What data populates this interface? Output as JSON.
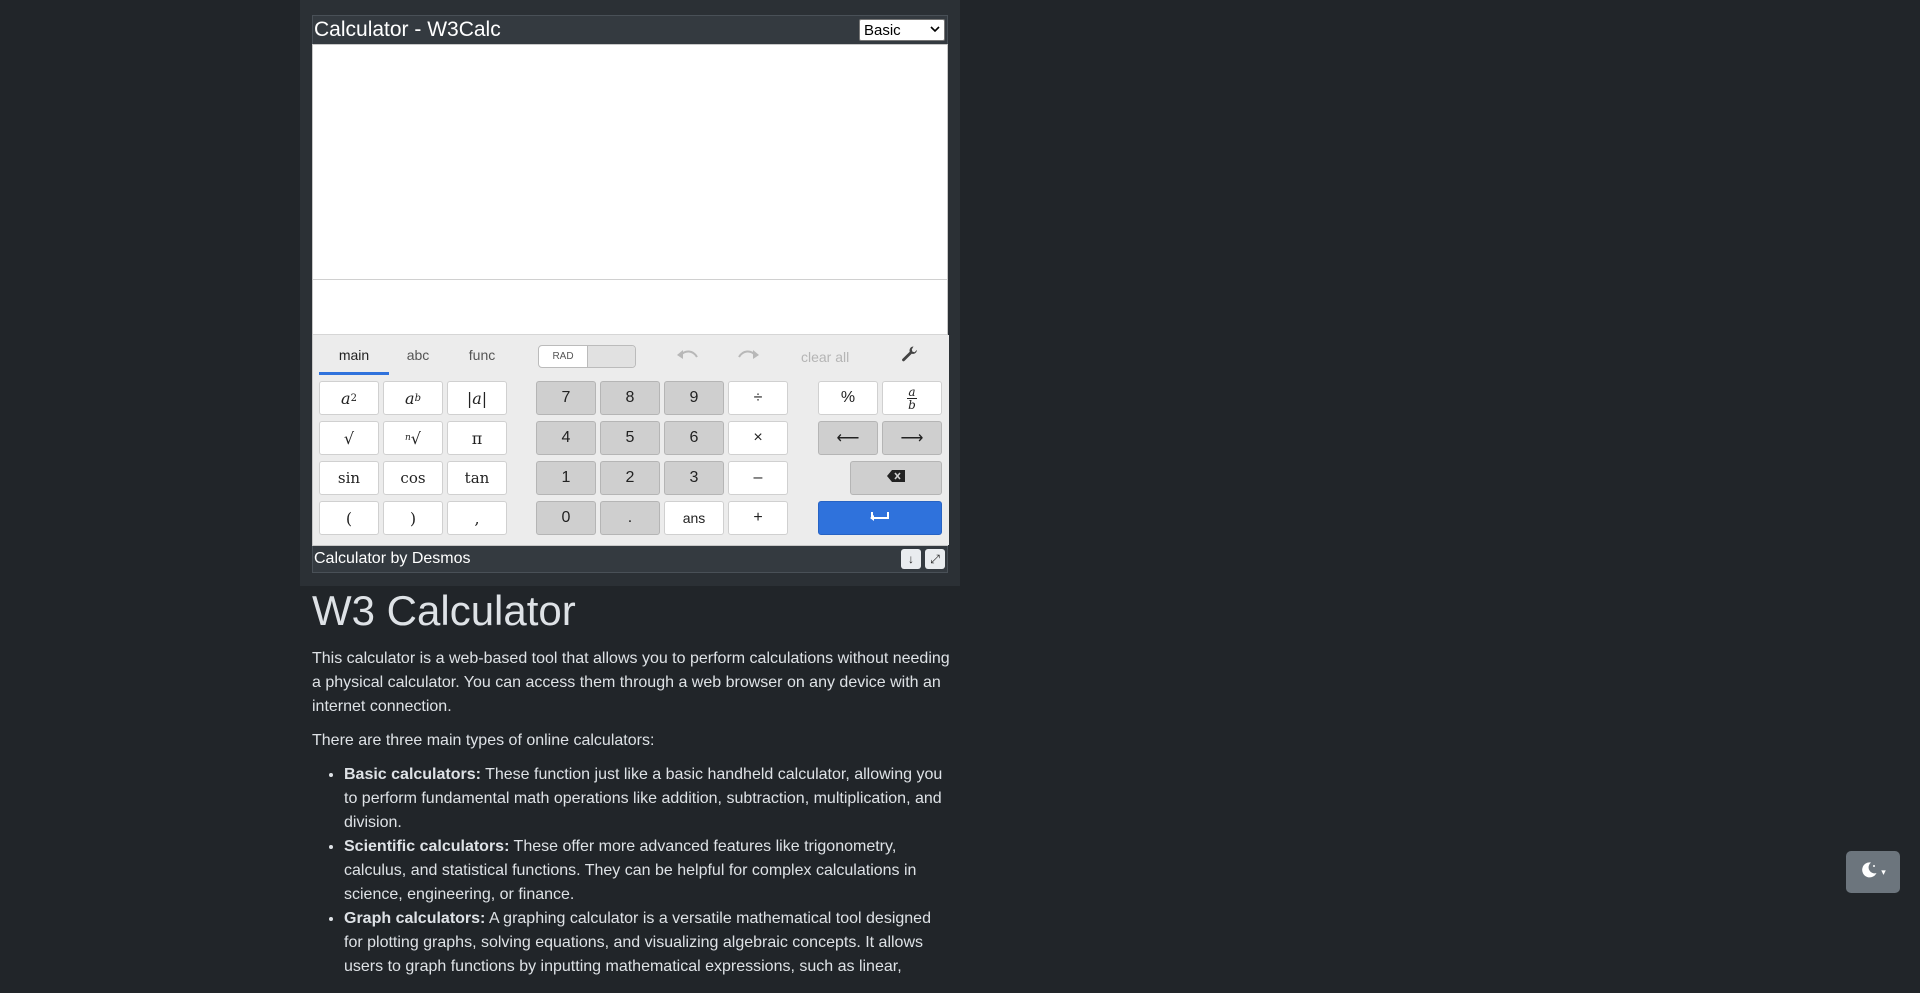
{
  "calculator": {
    "title": "Calculator - W3Calc",
    "mode": "Basic",
    "footer_text": "Calculator by Desmos",
    "download_icon": "↓",
    "expand_icon": "⤢"
  },
  "keypad": {
    "tabs": [
      "main",
      "abc",
      "func"
    ],
    "active_tab": "main",
    "rad_label": "RAD",
    "clear_all": "clear all",
    "keys": {
      "a_squared": "a",
      "a_squared_sup": "2",
      "a_power": "a",
      "a_power_sup": "b",
      "abs": "|a|",
      "sqrt": "√",
      "nth_root_n": "n",
      "nth_root": "√",
      "pi": "π",
      "sin": "sin",
      "cos": "cos",
      "tan": "tan",
      "lparen": "(",
      "rparen": ")",
      "comma": ",",
      "d7": "7",
      "d8": "8",
      "d9": "9",
      "divide": "÷",
      "d4": "4",
      "d5": "5",
      "d6": "6",
      "times": "×",
      "d1": "1",
      "d2": "2",
      "d3": "3",
      "minus": "–",
      "d0": "0",
      "dot": ".",
      "ans": "ans",
      "plus": "+",
      "percent": "%",
      "frac_a": "a",
      "frac_b": "b",
      "left": "⟵",
      "right": "⟶",
      "backspace": "⌫",
      "enter": "⮐"
    }
  },
  "article": {
    "heading": "W3 Calculator",
    "intro": "This calculator is a web-based tool that allows you to perform calculations without needing a physical calculator. You can access them through a web browser on any device with an internet connection.",
    "types_intro": "There are three main types of online calculators:",
    "items": [
      {
        "term": "Basic calculators:",
        "text": " These function just like a basic handheld calculator, allowing you to perform fundamental math operations like addition, subtraction, multiplication, and division."
      },
      {
        "term": "Scientific calculators:",
        "text": " These offer more advanced features like trigonometry, calculus, and statistical functions. They can be helpful for complex calculations in science, engineering, or finance."
      },
      {
        "term": "Graph calculators:",
        "text": " A graphing calculator is a versatile mathematical tool designed for plotting graphs, solving equations, and visualizing algebraic concepts. It allows users to graph functions by inputting mathematical expressions, such as linear,"
      }
    ]
  },
  "theme_toggle": {
    "icon": "moon-icon",
    "caret": "▾"
  }
}
